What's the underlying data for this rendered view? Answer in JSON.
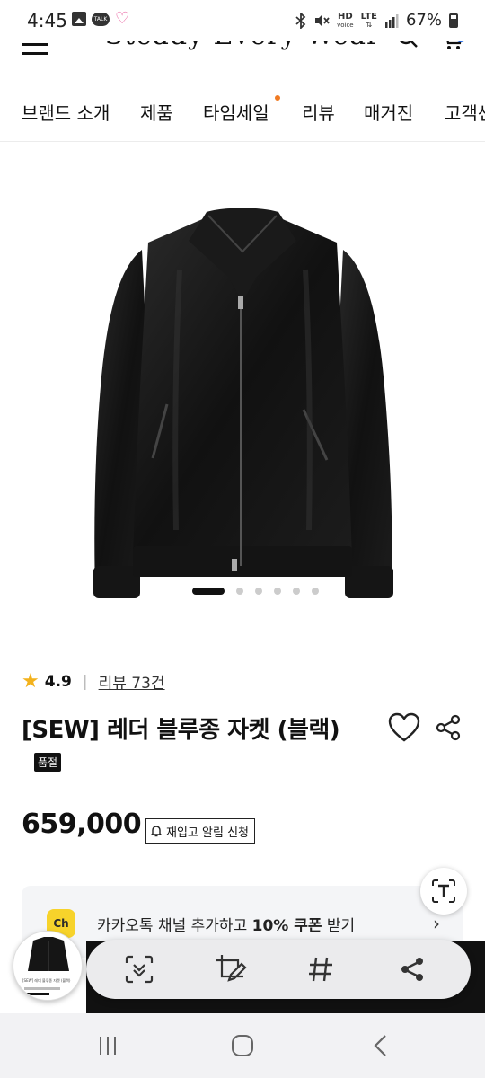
{
  "status_bar": {
    "time": "4:45",
    "talk_badge": "TALK",
    "hd_label": "HD",
    "voice_label": "voice",
    "lte_label": "LTE",
    "battery": "67%"
  },
  "header": {
    "brand": "Steady Every Wear",
    "menu_icon": "hamburger-icon",
    "search_icon": "search-icon",
    "cart_icon": "cart-icon",
    "cart_badge_color": "#2a6de8"
  },
  "nav": {
    "items": [
      {
        "label": "브랜드 소개"
      },
      {
        "label": "제품"
      },
      {
        "label": "타임세일",
        "dot": true
      },
      {
        "label": "리뷰"
      },
      {
        "label": "매거진"
      },
      {
        "label": "고객센터"
      }
    ],
    "dot_color": "#f07a22"
  },
  "gallery": {
    "image": "black-leather-blouson-jacket",
    "slide_count": 6,
    "active_index": 0
  },
  "product": {
    "rating": "4.9",
    "review_text": "리뷰 73건",
    "title": "[SEW] 레더 블루종 자켓 (블랙)",
    "badge": "품절",
    "price": "659,000",
    "restock_label": "재입고 알림 신청"
  },
  "kakao": {
    "logo": "Ch",
    "text_before": "카카오톡 채널 추가하고 ",
    "text_bold": "10% 쿠폰",
    "text_after": " 받기",
    "logo_color": "#f7d32b"
  },
  "toolbar": {
    "thumbnail_caption": "[SEW] 레더 블루종 자켓 (블랙)",
    "buttons": [
      "smart-select-icon",
      "edit-capture-icon",
      "hashtag-icon",
      "share-icon"
    ]
  },
  "android_nav": [
    "recents-icon",
    "home-icon",
    "back-icon"
  ]
}
